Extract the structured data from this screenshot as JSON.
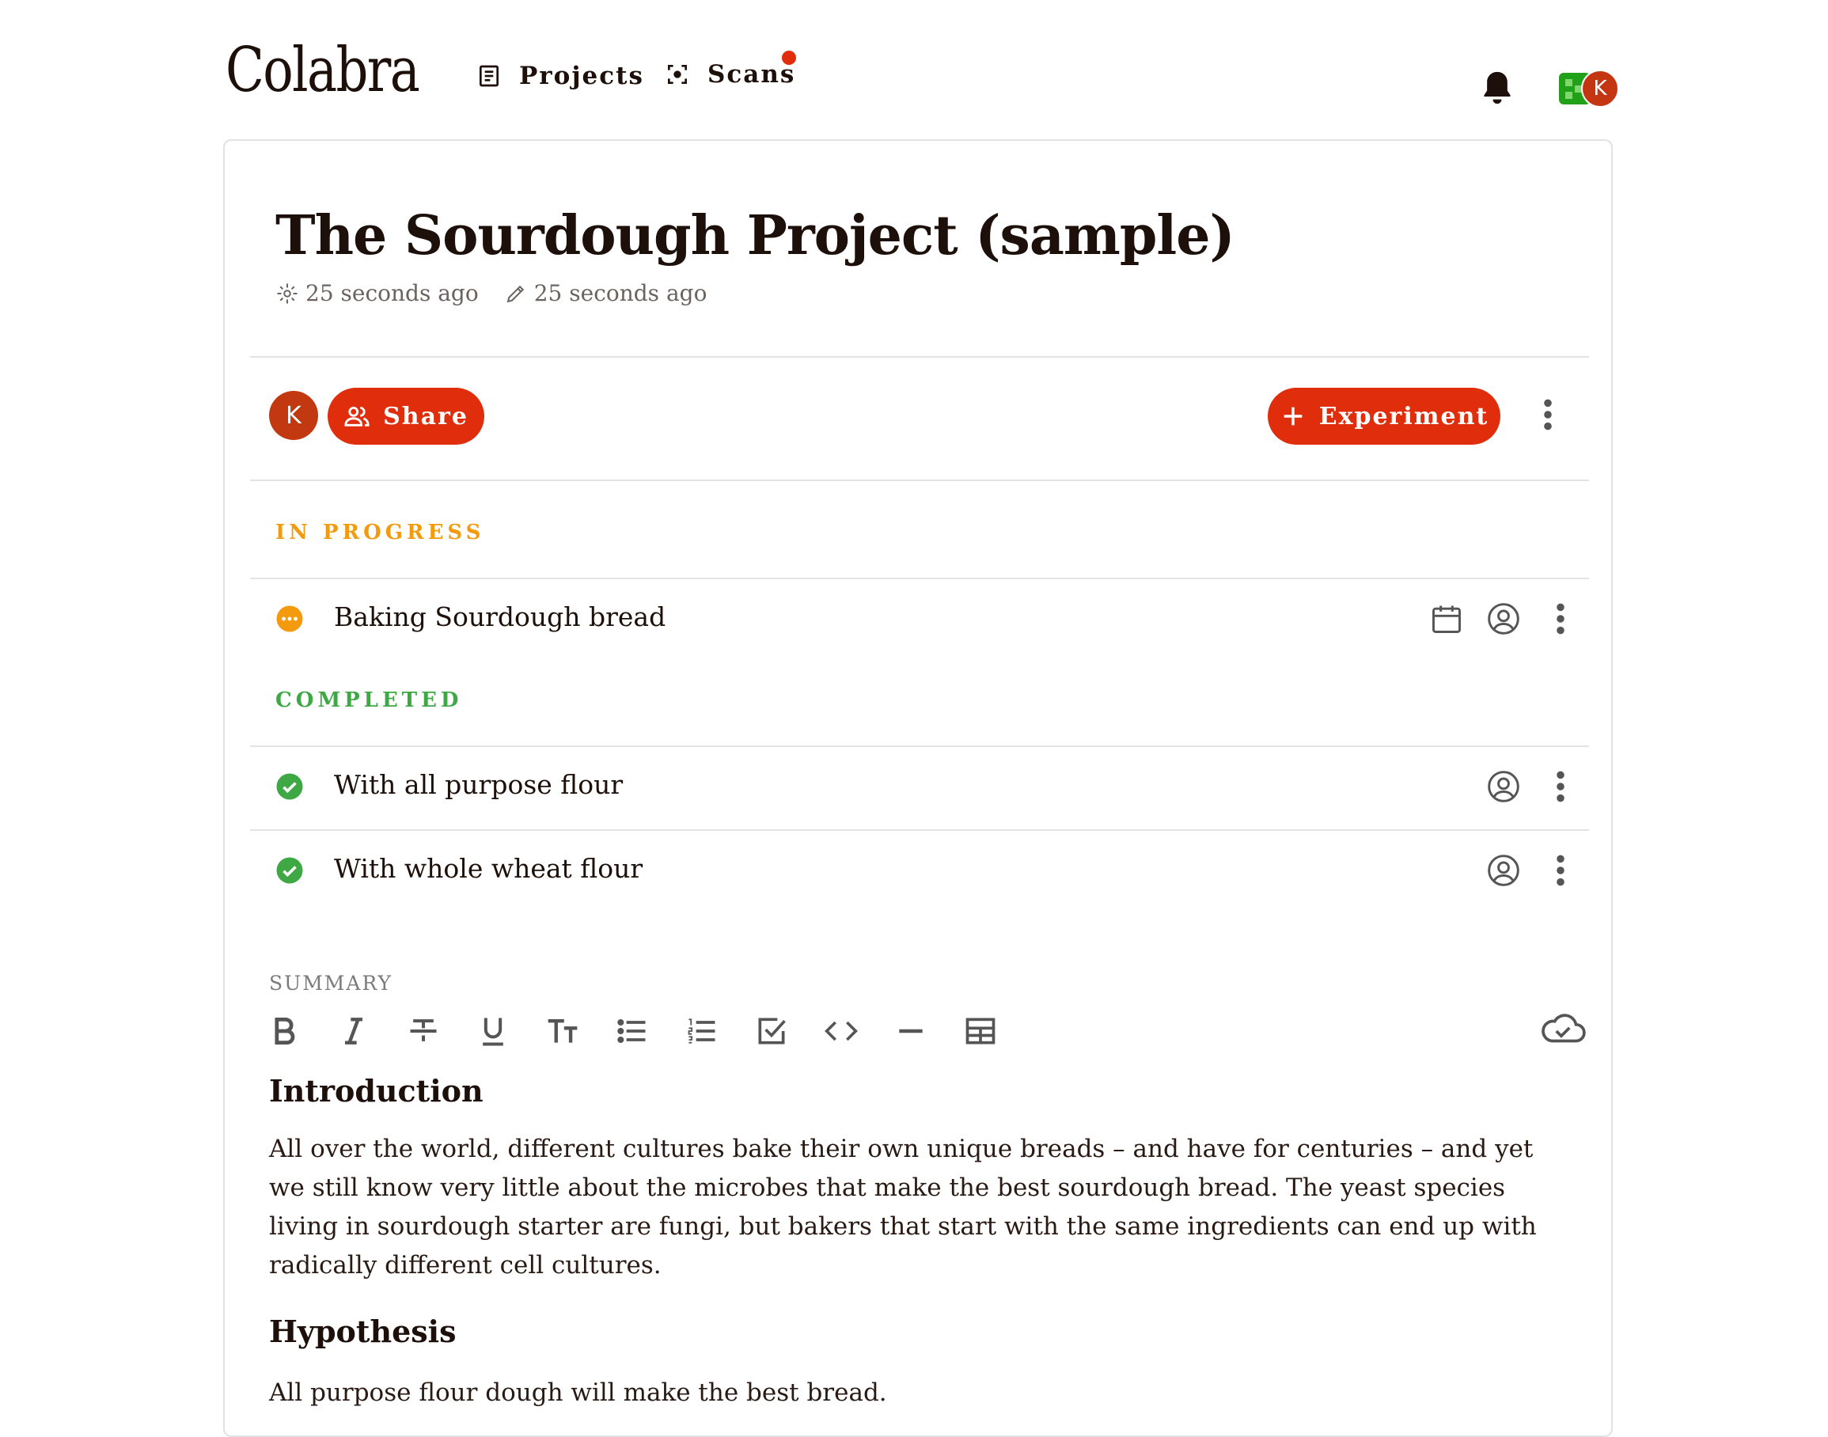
{
  "app": {
    "logo": "Colabra",
    "nav": {
      "projects": "Projects",
      "scans": "Scans"
    },
    "user_initial": "K"
  },
  "project": {
    "title": "The Sourdough Project (sample)",
    "created": "25 seconds ago",
    "edited": "25 seconds ago",
    "owner_initial": "K",
    "share_label": "Share",
    "experiment_label": "Experiment"
  },
  "sections": {
    "in_progress": {
      "label": "IN PROGRESS",
      "items": [
        {
          "name": "Baking Sourdough bread",
          "status": "in-progress"
        }
      ]
    },
    "completed": {
      "label": "COMPLETED",
      "items": [
        {
          "name": "With all purpose flour",
          "status": "completed"
        },
        {
          "name": "With whole wheat flour",
          "status": "completed"
        }
      ]
    }
  },
  "summary": {
    "label": "SUMMARY",
    "toolbar": [
      "bold-icon",
      "italic-icon",
      "strikethrough-icon",
      "underline-icon",
      "text-size-icon",
      "bullet-list-icon",
      "numbered-list-icon",
      "checklist-icon",
      "code-icon",
      "divider-icon",
      "table-icon"
    ],
    "intro_heading": "Introduction",
    "intro_text": "All over the world, different cultures bake their own unique breads – and have for centuries – and yet we still know very little about the microbes that make the best sourdough bread. The yeast species living in sourdough starter are fungi, but bakers that start with the same ingredients can end up with radically different cell cultures.",
    "hypothesis_heading": "Hypothesis",
    "hypothesis_text": "All purpose flour dough will make the best bread."
  },
  "colors": {
    "accent": "#e02d0c",
    "in_progress": "#f39a0e",
    "completed": "#3ea845",
    "text": "#1d0f0a"
  }
}
